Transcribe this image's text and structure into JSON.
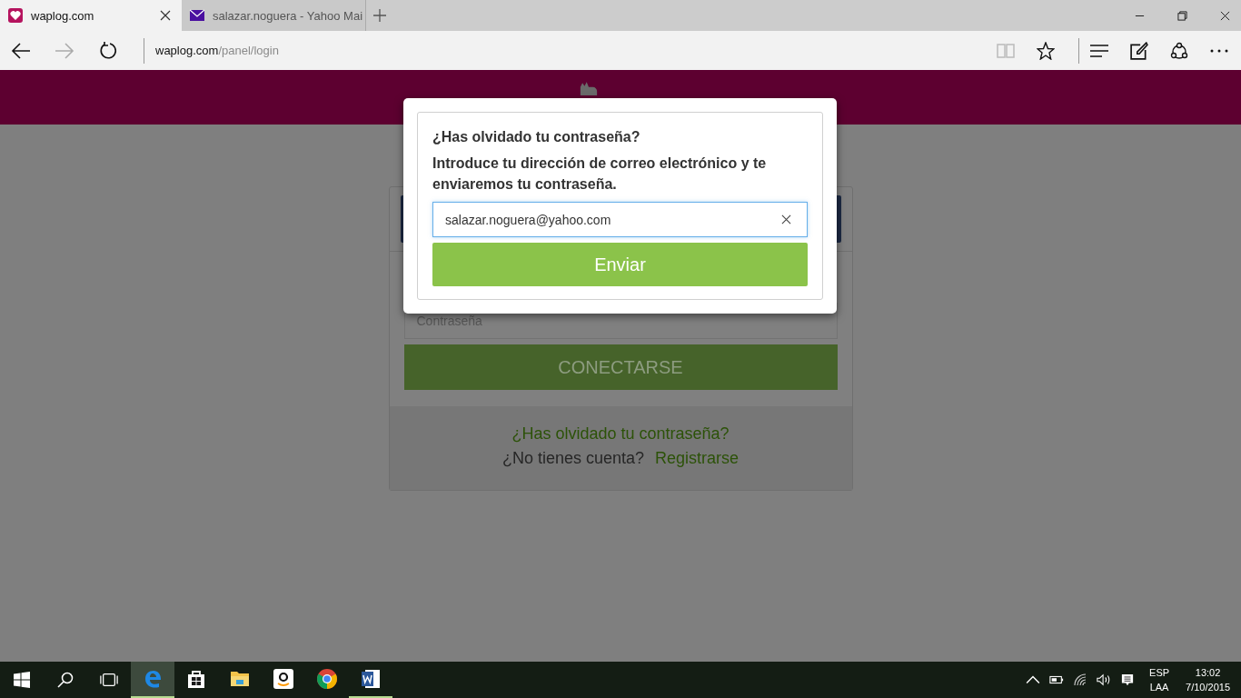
{
  "tabs": [
    {
      "title": "waplog.com",
      "selected": true,
      "kind": "heart"
    },
    {
      "title": "salazar.noguera - Yahoo Mai",
      "selected": false,
      "kind": "mail"
    }
  ],
  "address": {
    "domain": "waplog.com",
    "path": "/panel/login"
  },
  "login": {
    "password_placeholder": "Contraseña",
    "submit": "CONECTARSE",
    "forgot_link": "¿Has olvidado tu contraseña?",
    "no_account": "¿No tienes cuenta?",
    "register_link": "Registrarse"
  },
  "modal": {
    "title": "¿Has olvidado tu contraseña?",
    "instructions": "Introduce tu dirección de correo electrónico y te enviaremos tu contraseña.",
    "email_value": "salazar.noguera@yahoo.com",
    "send_button": "Enviar"
  },
  "taskbar": {
    "apps": [
      {
        "kind": "edge",
        "selected": true,
        "running": true
      },
      {
        "kind": "store",
        "selected": false,
        "running": false
      },
      {
        "kind": "explorer",
        "selected": false,
        "running": false
      },
      {
        "kind": "amazon",
        "selected": false,
        "running": false
      },
      {
        "kind": "chrome",
        "selected": false,
        "running": false
      },
      {
        "kind": "word",
        "selected": false,
        "running": true
      }
    ],
    "language": "ESP",
    "layout": "LAA",
    "time": "13:02",
    "date": "7/10/2015"
  }
}
